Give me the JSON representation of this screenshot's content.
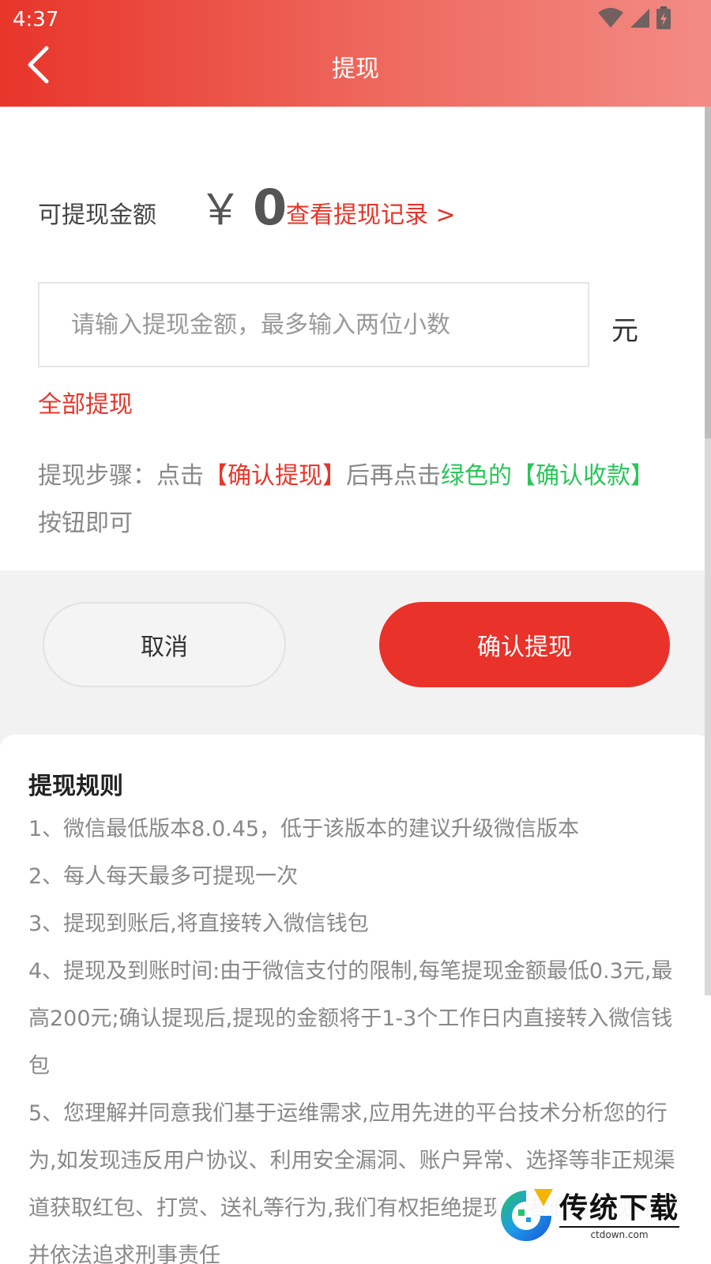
{
  "status_bar": {
    "time": "4:37"
  },
  "header": {
    "title": "提现"
  },
  "balance": {
    "label": "可提现金额",
    "currency": "￥",
    "amount": "0",
    "history_link": "查看提现记录 >"
  },
  "amount_input": {
    "placeholder": "请输入提现金额，最多输入两位小数",
    "value": "",
    "unit": "元"
  },
  "withdraw_all_label": "全部提现",
  "steps": {
    "part1": "提现步骤：点击",
    "part2": "【确认提现】",
    "part3": "后再点击",
    "part4": "绿色的【确认收款】",
    "part5": "按钮即可"
  },
  "buttons": {
    "cancel": "取消",
    "confirm": "确认提现"
  },
  "rules": {
    "title": "提现规则",
    "items": [
      "1、微信最低版本8.0.45，低于该版本的建议升级微信版本",
      "2、每人每天最多可提现一次",
      "3、提现到账后,将直接转入微信钱包",
      "4、提现及到账时间:由于微信支付的限制,每笔提现金额最低0.3元,最高200元;确认提现后,提现的金额将于1-3个工作日内直接转入微信钱包",
      "5、您理解并同意我们基于运维需求,应用先进的平台技术分析您的行为,如发现违反用户协议、利用安全漏洞、账户异常、选择等非正规渠道获取红包、打赏、送礼等行为,我们有权拒绝提现或者追回提现等,并依法追求刑事责任"
    ]
  },
  "watermark": {
    "cn": "传统下载",
    "en": "ctdown.com"
  },
  "colors": {
    "accent": "#e8352a",
    "highlight_green": "#2bc55a",
    "text_muted": "#888888"
  }
}
